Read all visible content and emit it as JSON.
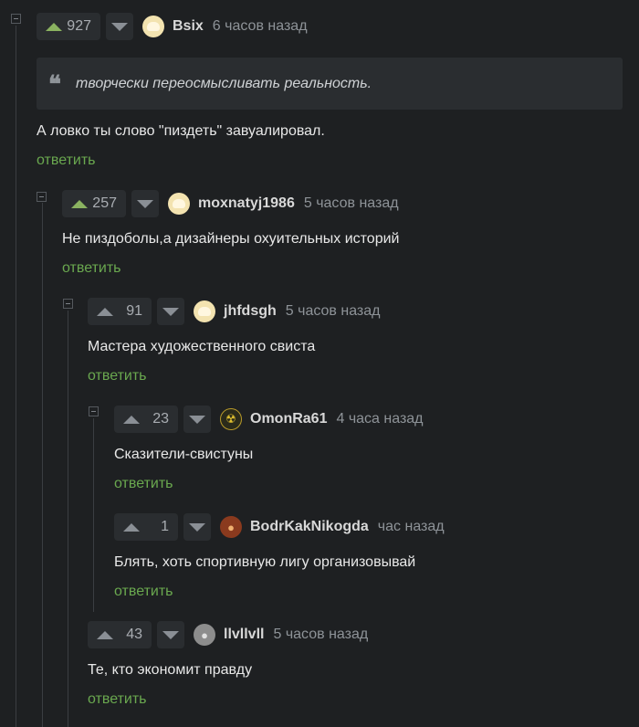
{
  "quote_block": {
    "icon": "quote-icon",
    "text": "творчески переосмысливать реальность."
  },
  "reply_label": "ответить",
  "comments": [
    {
      "rating": "927",
      "vote": "up",
      "avatar": "default-avatar",
      "username": "Bsix",
      "time": "6 часов назад",
      "text": "А ловко ты слово \"пиздеть\" завуалировал."
    },
    {
      "rating": "257",
      "vote": "up",
      "avatar": "default-avatar",
      "username": "moxnatyj1986",
      "time": "5 часов назад",
      "text": "Не пиздоболы,а дизайнеры охуительных историй"
    },
    {
      "rating": "91",
      "vote": "none",
      "avatar": "default-avatar",
      "username": "jhfdsgh",
      "time": "5 часов назад",
      "text": "Мастера художественного свиста"
    },
    {
      "rating": "23",
      "vote": "none",
      "avatar": "radiation-avatar",
      "username": "OmonRa61",
      "time": "4 часа назад",
      "text": "Сказители-свистуны"
    },
    {
      "rating": "1",
      "vote": "none",
      "avatar": "fox-avatar",
      "username": "BodrKakNikogda",
      "time": "час назад",
      "text": "Блять, хоть спортивную лигу организовывай"
    },
    {
      "rating": "43",
      "vote": "none",
      "avatar": "face-avatar",
      "username": "llvllvll",
      "time": "5 часов назад",
      "text": "Те, кто экономит правду"
    }
  ],
  "colors": {
    "background": "#1e2022",
    "upvoted": "#8ab260",
    "reply": "#6aa84f",
    "panel": "#2a2d30"
  }
}
